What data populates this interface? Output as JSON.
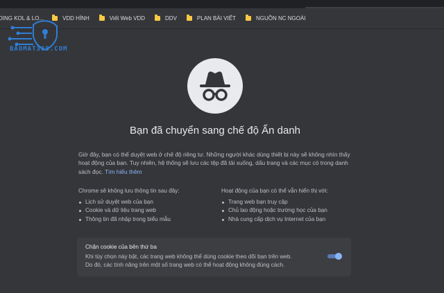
{
  "bookmarks": [
    {
      "label": "DING KOL & LO...",
      "icon": "folder-icon"
    },
    {
      "label": "VDD HÌNH",
      "icon": "folder-icon"
    },
    {
      "label": "Viết Web VDD",
      "icon": "folder-icon"
    },
    {
      "label": "DDV",
      "icon": "folder-icon"
    },
    {
      "label": "PLAN BÀI VIẾT",
      "icon": "folder-icon"
    },
    {
      "label": "NGUỒN NC NGOÀI",
      "icon": "folder-icon"
    }
  ],
  "watermark": {
    "text": "BAOMAT360.COM",
    "color": "#2f7fd8"
  },
  "incognito": {
    "icon": "incognito-icon",
    "title": "Bạn đã chuyển sang chế độ Ẩn danh",
    "intro": "Giờ đây, bạn có thể duyệt web ở chế độ riêng tư. Những người khác dùng thiết bị này sẽ không nhìn thấy hoạt động của bạn. Tuy nhiên, hệ thống sẽ lưu các tệp đã tải xuống, dấu trang và các mục có trong danh sách đọc.",
    "learn_more": "Tìm hiểu thêm"
  },
  "left_column": {
    "heading": "Chrome sẽ không lưu thông tin sau đây:",
    "items": [
      "Lịch sử duyệt web của bạn",
      "Cookie và dữ liệu trang web",
      "Thông tin đã nhập trong biểu mẫu"
    ]
  },
  "right_column": {
    "heading": "Hoạt động của bạn có thể vẫn hiển thị với:",
    "items": [
      "Trang web bạn truy cập",
      "Chủ lao động hoặc trường học của bạn",
      "Nhà cung cấp dịch vụ Internet của bạn"
    ]
  },
  "cookie_card": {
    "title": "Chặn cookie của bên thứ ba",
    "line1": "Khi tùy chọn này bật, các trang web không thể dùng cookie theo dõi bạn trên web.",
    "line2": "Do đó, các tính năng trên một số trang web có thể hoạt động không đúng cách.",
    "toggle_on": true,
    "accent": "#8ab4f8"
  },
  "colors": {
    "background": "#35363a",
    "text": "#e8eaed",
    "muted": "#bdc1c6",
    "link": "#8ab4f8",
    "folder": "#f9c846"
  }
}
